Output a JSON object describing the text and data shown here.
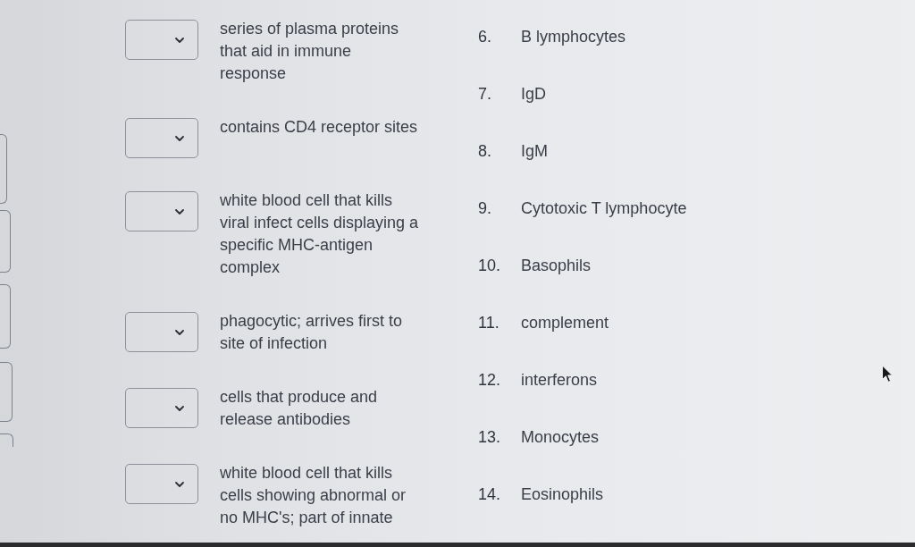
{
  "matching": {
    "prompts": [
      {
        "description": "series of plasma proteins\nthat aid in immune\nresponse"
      },
      {
        "description": "contains CD4 receptor sites"
      },
      {
        "description": "white blood cell that kills\nviral infect cells displaying a\nspecific MHC-antigen\ncomplex"
      },
      {
        "description": "phagocytic; arrives first to\nsite of infection"
      },
      {
        "description": "cells that produce and\nrelease antibodies"
      },
      {
        "description": "white blood cell that kills\ncells showing abnormal or\nno MHC's; part of innate"
      }
    ],
    "choices": [
      {
        "number": "6.",
        "label": "B lymphocytes"
      },
      {
        "number": "7.",
        "label": "IgD"
      },
      {
        "number": "8.",
        "label": "IgM"
      },
      {
        "number": "9.",
        "label": "Cytotoxic T lymphocyte"
      },
      {
        "number": "10.",
        "label": "Basophils"
      },
      {
        "number": "11.",
        "label": "complement"
      },
      {
        "number": "12.",
        "label": "interferons"
      },
      {
        "number": "13.",
        "label": "Monocytes"
      },
      {
        "number": "14.",
        "label": "Eosinophils"
      }
    ]
  }
}
